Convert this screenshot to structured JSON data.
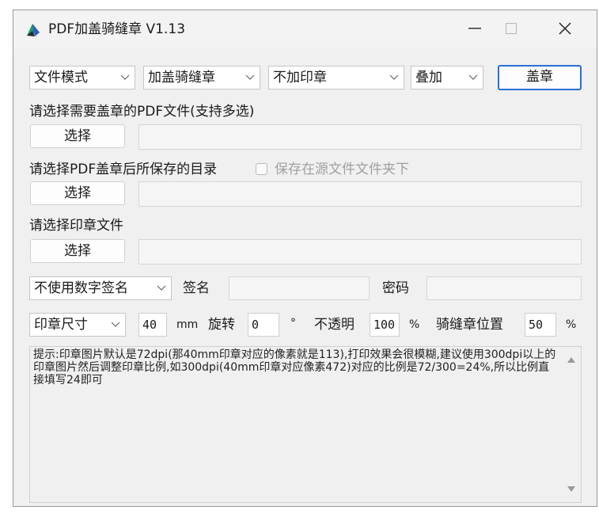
{
  "window": {
    "title": "PDF加盖骑缝章 V1.13"
  },
  "toolbar": {
    "mode": "文件模式",
    "stamp_type": "加盖骑缝章",
    "seal_option": "不加印章",
    "blend": "叠加",
    "stamp_button": "盖章"
  },
  "pdf_section": {
    "label": "请选择需要盖章的PDF文件(支持多选)",
    "button": "选择",
    "path": ""
  },
  "output_section": {
    "label": "请选择PDF盖章后所保存的目录",
    "checkbox_label": "保存在源文件文件夹下",
    "button": "选择",
    "path": ""
  },
  "seal_section": {
    "label": "请选择印章文件",
    "button": "选择",
    "path": ""
  },
  "signature": {
    "mode": "不使用数字签名",
    "sign_label": "签名",
    "sign_value": "",
    "password_label": "密码",
    "password_value": ""
  },
  "params": {
    "size_mode": "印章尺寸",
    "size_value": "40",
    "size_unit": "mm",
    "rotate_label": "旋转",
    "rotate_value": "0",
    "rotate_unit": "°",
    "opacity_label": "不透明",
    "opacity_value": "100",
    "opacity_unit": "%",
    "position_label": "骑缝章位置",
    "position_value": "50",
    "position_unit": "%"
  },
  "notes": {
    "text": "提示:印章图片默认是72dpi(那40mm印章对应的像素就是113),打印效果会很模糊,建议使用300dpi以上的印章图片然后调整印章比例,如300dpi(40mm印章对应像素472)对应的比例是72/300=24%,所以比例直接填写24即可"
  },
  "colors": {
    "accent": "#2a6fd6",
    "window_bg": "#f0f0f0"
  }
}
